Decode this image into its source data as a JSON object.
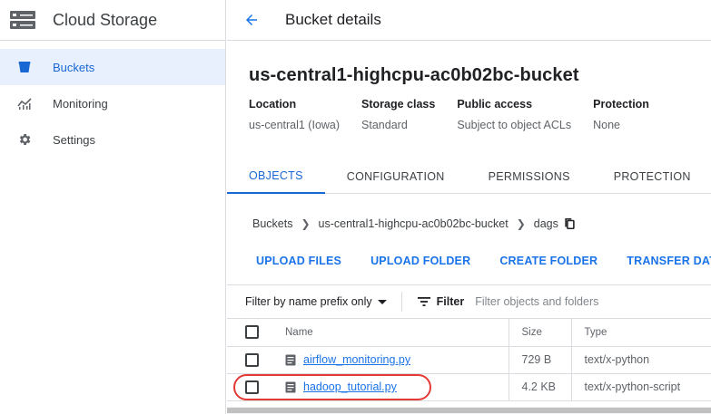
{
  "sidebar": {
    "title": "Cloud Storage",
    "items": [
      {
        "label": "Buckets",
        "icon": "bucket-icon"
      },
      {
        "label": "Monitoring",
        "icon": "chart-icon"
      },
      {
        "label": "Settings",
        "icon": "gear-icon"
      }
    ]
  },
  "header": {
    "title": "Bucket details"
  },
  "bucket": {
    "name": "us-central1-highcpu-ac0b02bc-bucket",
    "props": [
      {
        "key": "Location",
        "value": "us-central1 (Iowa)"
      },
      {
        "key": "Storage class",
        "value": "Standard"
      },
      {
        "key": "Public access",
        "value": "Subject to object ACLs"
      },
      {
        "key": "Protection",
        "value": "None"
      }
    ]
  },
  "tabs": [
    "OBJECTS",
    "CONFIGURATION",
    "PERMISSIONS",
    "PROTECTION"
  ],
  "breadcrumb": [
    "Buckets",
    "us-central1-highcpu-ac0b02bc-bucket",
    "dags"
  ],
  "actions": {
    "upload_files": "UPLOAD FILES",
    "upload_folder": "UPLOAD FOLDER",
    "create_folder": "CREATE FOLDER",
    "transfer_data": "TRANSFER DATA"
  },
  "filter": {
    "prefix_label": "Filter by name prefix only",
    "label": "Filter",
    "placeholder": "Filter objects and folders"
  },
  "table": {
    "headers": {
      "name": "Name",
      "size": "Size",
      "type": "Type"
    },
    "rows": [
      {
        "name": "airflow_monitoring.py",
        "size": "729 B",
        "type": "text/x-python"
      },
      {
        "name": "hadoop_tutorial.py",
        "size": "4.2 KB",
        "type": "text/x-python-script"
      }
    ]
  },
  "colors": {
    "accent": "#1a73e8",
    "active_nav_bg": "#e8f0fe",
    "highlight": "#e53935"
  }
}
